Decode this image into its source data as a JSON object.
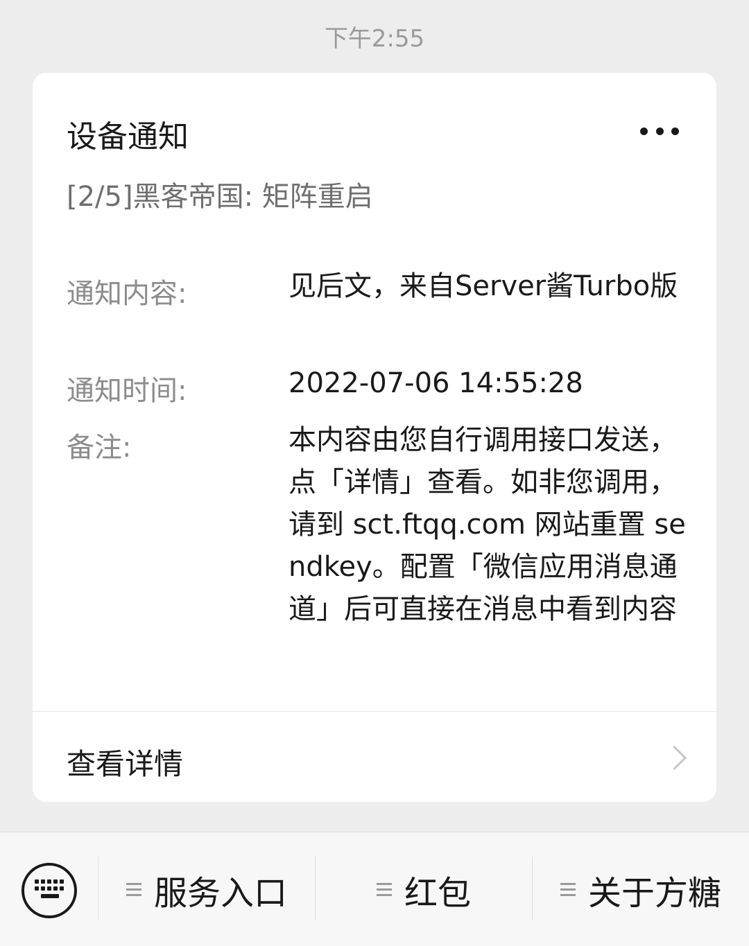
{
  "timestamp": "下午2:55",
  "card": {
    "title": "设备通知",
    "subtitle": "[2/5]黑客帝国: 矩阵重启",
    "fields": [
      {
        "label": "通知内容:",
        "value": "见后文，来自Server酱Turbo版"
      },
      {
        "label": "通知时间:",
        "value": "2022-07-06 14:55:28"
      },
      {
        "label": "备注:",
        "value": "本内容由您自行调用接口发送，点「详情」查看。如非您调用，请到 sct.ftqq.com 网站重置 sendkey。配置「微信应用消息通道」后可直接在消息中看到内容"
      }
    ],
    "detail_label": "查看详情"
  },
  "menu": {
    "items": [
      {
        "label": "服务入口"
      },
      {
        "label": "红包"
      },
      {
        "label": "关于方糖"
      }
    ]
  },
  "icons": {
    "more": "more-dots-icon",
    "chevron": "chevron-right-icon",
    "keyboard": "keyboard-icon",
    "menu": "menu-lines-icon"
  }
}
